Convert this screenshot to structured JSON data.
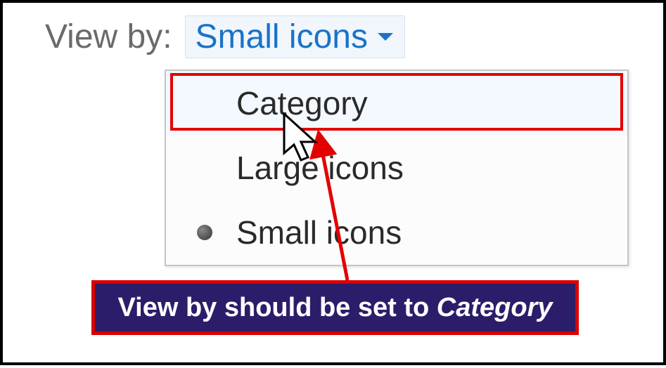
{
  "view_by": {
    "label": "View by:",
    "selected": "Small icons"
  },
  "menu": {
    "items": [
      {
        "label": "Category",
        "selected": false,
        "highlighted": true
      },
      {
        "label": "Large icons",
        "selected": false,
        "highlighted": false
      },
      {
        "label": "Small icons",
        "selected": true,
        "highlighted": false
      }
    ]
  },
  "annotation": {
    "prefix": "View by should be set to ",
    "emphasis": "Category"
  },
  "colors": {
    "highlight_border": "#e30000",
    "annotation_bg": "#2c1d6a",
    "annotation_border": "#d90000",
    "link": "#1a73c7"
  }
}
